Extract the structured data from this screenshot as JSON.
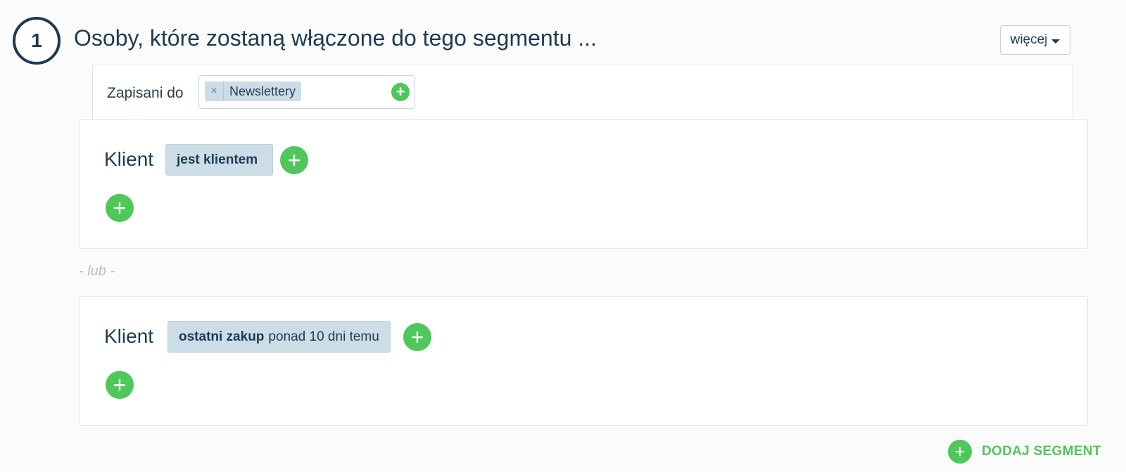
{
  "header": {
    "step_number": "1",
    "title": "Osoby, które zostaną włączone do tego segmentu ...",
    "more_label": "więcej"
  },
  "subscribed": {
    "label": "Zapisani do",
    "tags": [
      {
        "remove": "×",
        "label": "Newslettery"
      }
    ],
    "add_symbol": "+"
  },
  "rules": [
    {
      "label": "Klient",
      "condition": {
        "bold": "jest klientem",
        "rest": ""
      },
      "add_symbol": "+"
    },
    {
      "label": "Klient",
      "condition": {
        "bold": "ostatni zakup",
        "rest": "ponad 10 dni temu"
      },
      "add_symbol": "+"
    }
  ],
  "separator": "- lub -",
  "add_segment": {
    "symbol": "+",
    "label": "DODAJ SEGMENT"
  },
  "colors": {
    "primary": "#1d3b52",
    "accent_green": "#4fc75a",
    "chip_bg": "#cddde8",
    "border": "#e3e6e9"
  }
}
